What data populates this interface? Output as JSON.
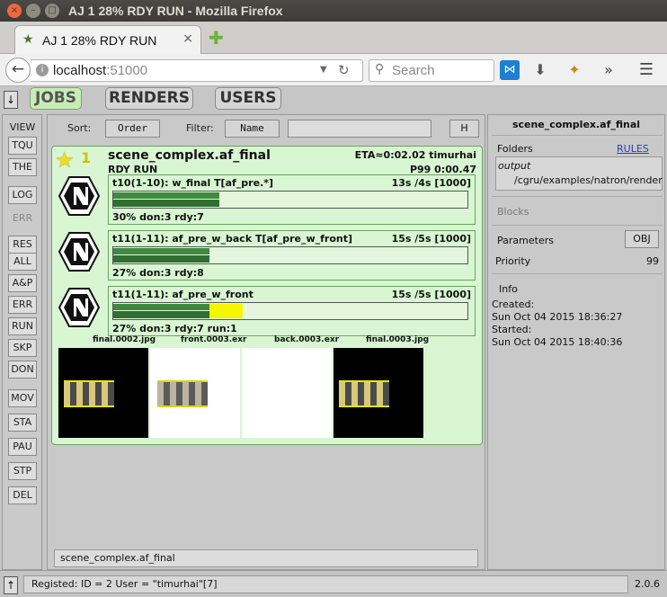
{
  "window": {
    "title": "AJ 1 28% RDY RUN - Mozilla Firefox",
    "close_glyph": "×",
    "min_glyph": "–",
    "max_glyph": "□"
  },
  "tab": {
    "title": "AJ 1 28% RDY RUN",
    "close_glyph": "×"
  },
  "navbar": {
    "url_host": "localhost",
    "url_port": ":51000",
    "search_placeholder": "Search",
    "icons": [
      "back-icon",
      "info-icon",
      "dropdown-icon",
      "reload-icon",
      "search-icon",
      "extension-icon",
      "download-icon",
      "addon-icon",
      "overflow-icon",
      "menu-icon"
    ]
  },
  "top_tabs": [
    {
      "label": "JOBS",
      "active": true
    },
    {
      "label": "RENDERS",
      "active": false
    },
    {
      "label": "USERS",
      "active": false
    }
  ],
  "left_buttons": [
    "VIEW",
    "TQU",
    "THE",
    "LOG",
    "ERR",
    "RES",
    "ALL",
    "A&P",
    "ERR",
    "RUN",
    "SKP",
    "DON",
    "MOV",
    "STA",
    "PAU",
    "STP",
    "DEL"
  ],
  "sortbar": {
    "sort_label": "Sort:",
    "sort_value": "Order",
    "filter_label": "Filter:",
    "filter_value": "Name",
    "filter_text": "",
    "h_button": "H"
  },
  "job": {
    "star_num": "1",
    "name": "scene_complex.af_final",
    "state": "RDY RUN",
    "eta": "ETA≈0:02.02 timurhai",
    "priority": "P99 0:00.47",
    "blocks": [
      {
        "title": "t10(1-10): w_final  T[af_pre.*]",
        "time": "13s /4s [1000]",
        "stat": "30% don:3 rdy:7",
        "done_fraction": 0.3,
        "running_fraction": 0.0
      },
      {
        "title": "t11(1-11): af_pre_w_back  T[af_pre_w_front]",
        "time": "15s /5s [1000]",
        "stat": "27% don:3 rdy:8",
        "done_fraction": 0.27,
        "running_fraction": 0.0
      },
      {
        "title": "t11(1-11): af_pre_w_front",
        "time": "15s /5s [1000]",
        "stat": "27% don:3 rdy:7 run:1",
        "done_fraction": 0.27,
        "running_fraction": 0.09
      }
    ],
    "thumbnails": [
      "final.0002.jpg",
      "front.0003.exr",
      "back.0003.exr",
      "final.0003.jpg"
    ]
  },
  "bottom_name": "scene_complex.af_final",
  "right": {
    "title": "scene_complex.af_final",
    "folders_label": "Folders",
    "rules_link": "RULES",
    "output_label": "output",
    "output_path": "/cgru/examples/natron/render",
    "blocks_label": "Blocks",
    "parameters_label": "Parameters",
    "obj_button": "OBJ",
    "priority_label": "Priority",
    "priority_value": "99",
    "info_label": "Info",
    "created_label": "Created:",
    "created_value": "Sun Oct 04 2015 18:36:27",
    "started_label": "Started:",
    "started_value": "Sun Oct 04 2015 18:40:36"
  },
  "status": {
    "text": "Registed: ID = 2 User = \"timurhai\"[7]",
    "version": "2.0.6"
  },
  "colors": {
    "job_bg": "#d9f6d3",
    "active_tab": "#c8ecb7",
    "done_bar": "#2f6f2f",
    "running_bar": "#f5f500",
    "star": "#f0de15"
  }
}
